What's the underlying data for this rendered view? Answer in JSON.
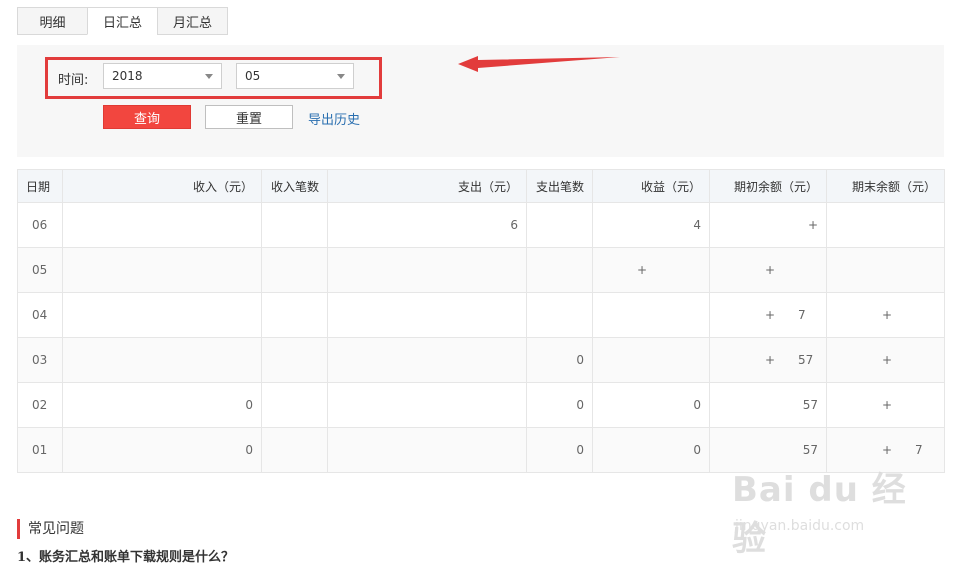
{
  "tabs": [
    {
      "label": "明细",
      "active": false
    },
    {
      "label": "日汇总",
      "active": true
    },
    {
      "label": "月汇总",
      "active": false
    }
  ],
  "filter": {
    "time_label": "时间:",
    "year_value": "2018",
    "month_value": "05",
    "query_label": "查询",
    "reset_label": "重置",
    "export_label": "导出历史"
  },
  "table": {
    "headers": [
      "日期",
      "收入（元）",
      "收入笔数",
      "支出（元）",
      "支出笔数",
      "收益（元）",
      "期初余额（元）",
      "期末余额（元）"
    ],
    "rows": [
      {
        "date": "06",
        "income": "",
        "income_count": "",
        "expense": "6",
        "expense_count": "",
        "profit": "4",
        "opening": "+",
        "closing": ""
      },
      {
        "date": "05",
        "income": "",
        "income_count": "",
        "expense": "",
        "expense_count": "",
        "profit": "+",
        "opening": "+",
        "closing": ""
      },
      {
        "date": "04",
        "income": "",
        "income_count": "",
        "expense": "",
        "expense_count": "",
        "profit": "",
        "opening": "+      7",
        "closing": "+"
      },
      {
        "date": "03",
        "income": "",
        "income_count": "",
        "expense": "",
        "expense_count": "0",
        "profit": "",
        "opening": "+      57",
        "closing": "+"
      },
      {
        "date": "02",
        "income": "0",
        "income_count": "",
        "expense": "",
        "expense_count": "0",
        "profit": "0",
        "opening": "57",
        "closing": "+"
      },
      {
        "date": "01",
        "income": "0",
        "income_count": "",
        "expense": "",
        "expense_count": "0",
        "profit": "0",
        "opening": "57",
        "closing": "+      7"
      }
    ]
  },
  "faq": {
    "title": "常见问题",
    "question_1": "1、账务汇总和账单下载规则是什么？"
  },
  "watermark": {
    "main": "Bai du 经验",
    "url": "jingyan.baidu.com"
  },
  "colors": {
    "accent_red": "#f2463f",
    "link_blue": "#2a6fb0",
    "positive_green": "#3aa83a",
    "negative_red": "#e64545"
  }
}
